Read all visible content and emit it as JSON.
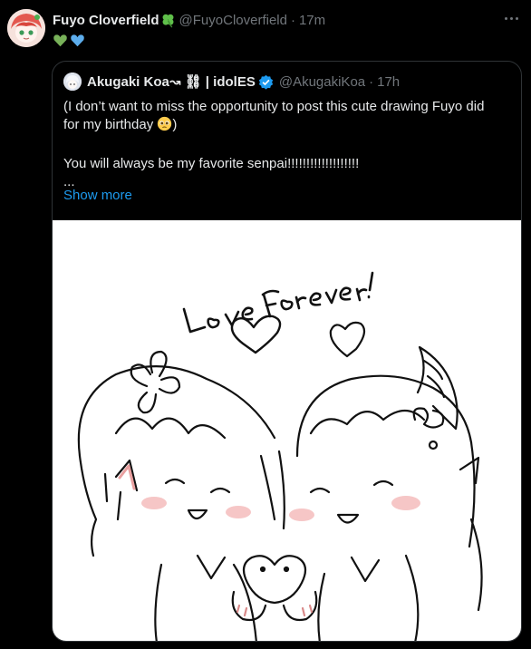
{
  "tweet": {
    "author": {
      "name": "Fuyo Cloverfield",
      "handle": "@FuyoCloverfield",
      "time": "17m",
      "name_icon": "four-leaf-clover-icon"
    },
    "text_icons": [
      "green-heart-icon",
      "blue-heart-icon"
    ],
    "more_icon": "more-options-icon"
  },
  "quote": {
    "author": {
      "name": "Akugaki Koa ",
      "name_suffix": "↝ ⛓ | idolES",
      "handle": "@AkugakiKoa",
      "time": "17h",
      "verified": true
    },
    "lines": [
      "(I don’t want to miss the opportunity to post this cute drawing Fuyo did",
      "for my birthday",
      "",
      "You will always be my favorite senpai!!!!!!!!!!!!!!!!!!!",
      "..."
    ],
    "show_more": "Show more",
    "image": {
      "caption_text": "Love Forever !",
      "kind": "line-art-drawing"
    }
  },
  "colors": {
    "background": "#000000",
    "text": "#e7e9ea",
    "muted": "#71767b",
    "link": "#1d9bf0",
    "border": "#2f3336"
  }
}
